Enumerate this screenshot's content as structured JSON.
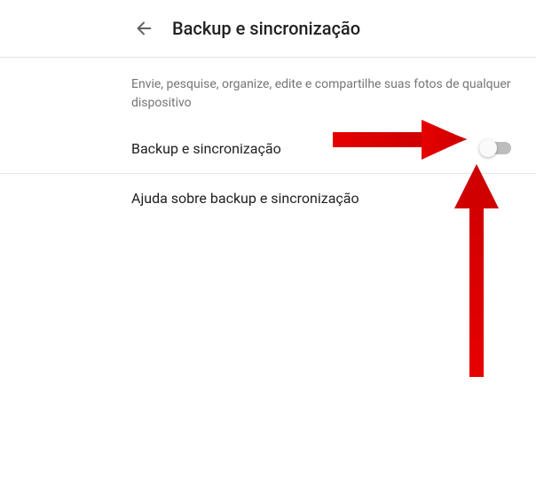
{
  "header": {
    "title": "Backup e sincronização"
  },
  "description": "Envie, pesquise, organize, edite e compartilhe suas fotos de qualquer dispositivo",
  "rows": {
    "backup_sync": {
      "label": "Backup e sincronização",
      "toggle_on": false
    },
    "help": {
      "label": "Ajuda sobre backup e sincronização"
    }
  },
  "annotations": {
    "arrow_color": "#e60000"
  }
}
